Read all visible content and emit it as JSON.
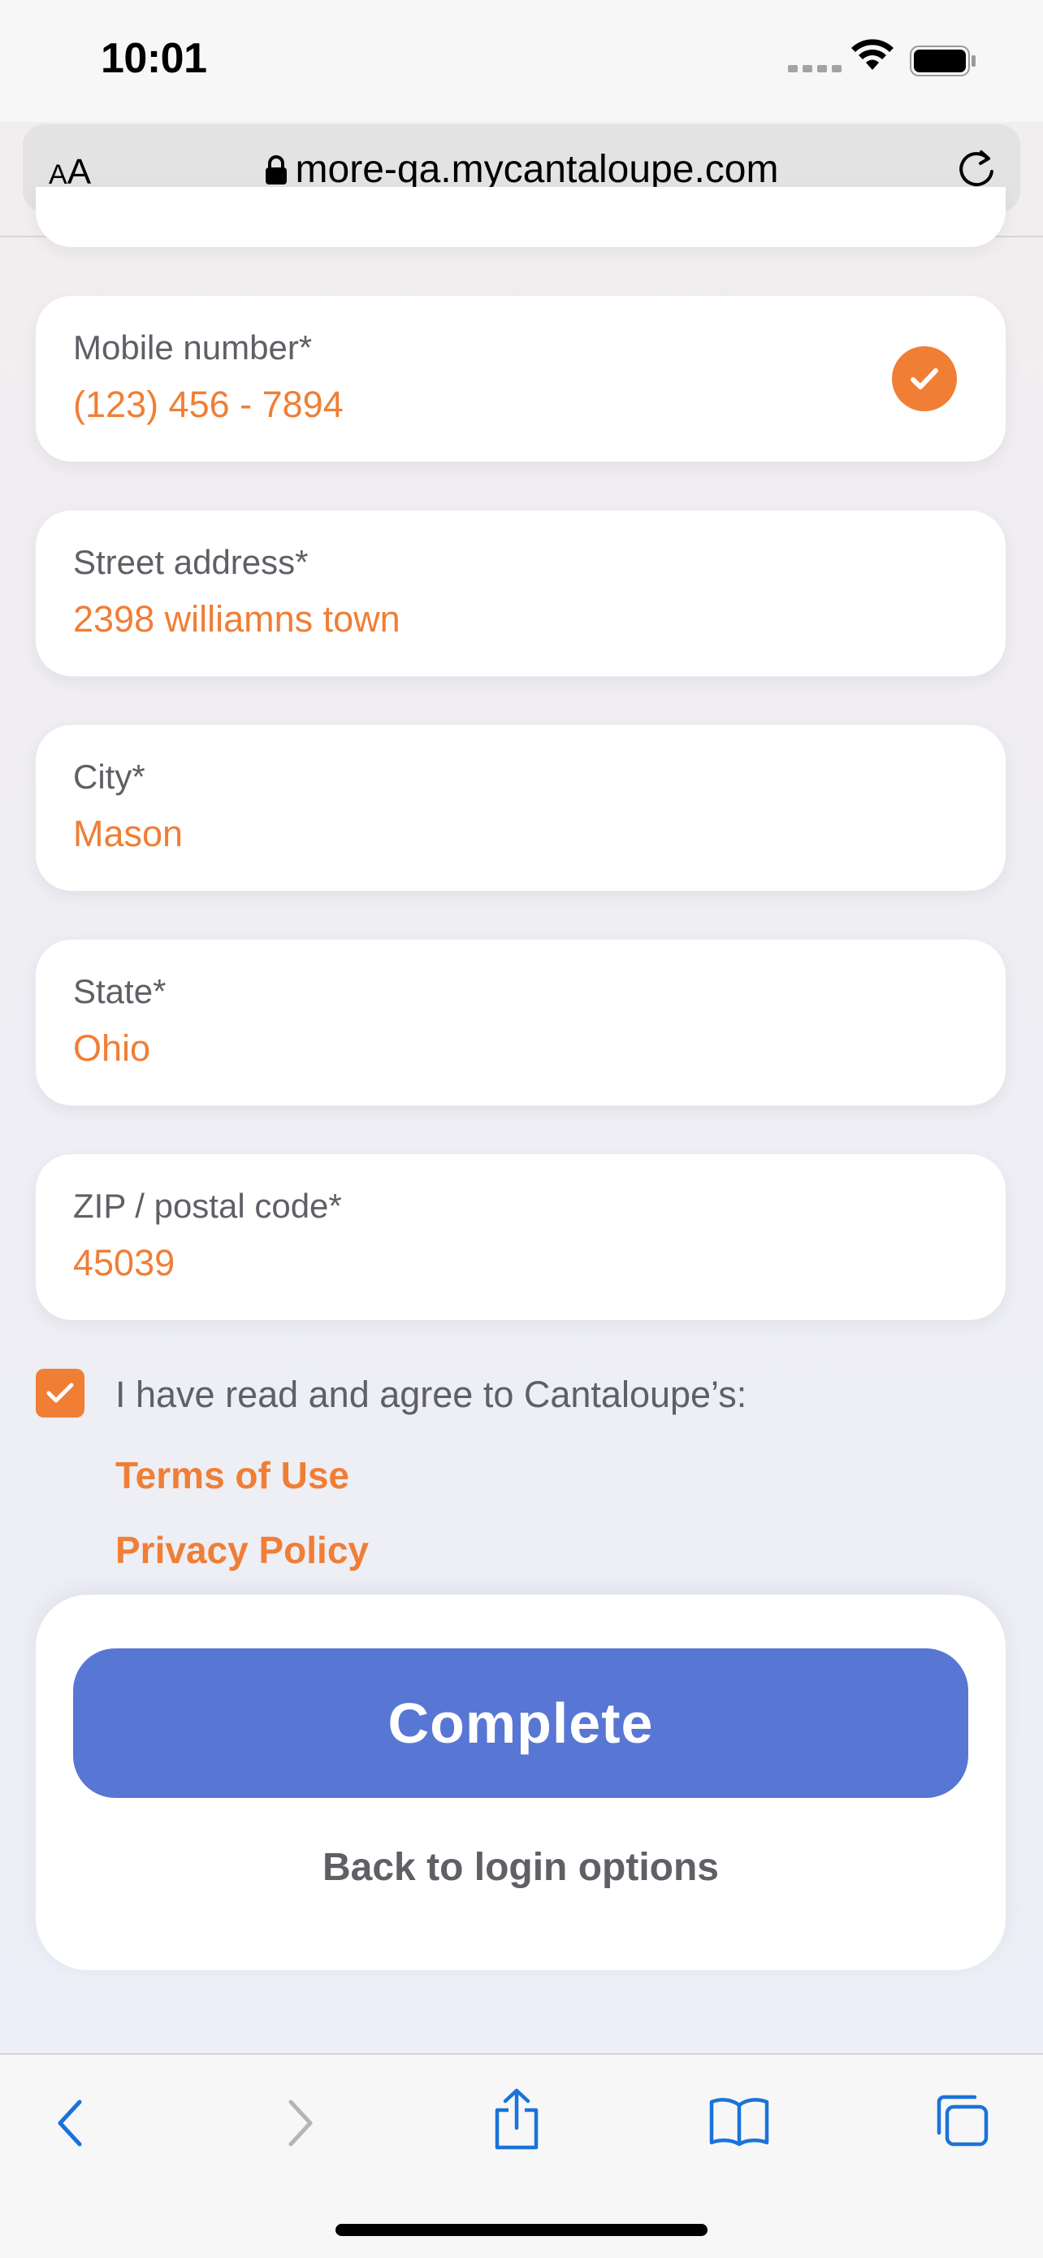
{
  "status_bar": {
    "time": "10:01"
  },
  "browser": {
    "text_size_label_small": "A",
    "text_size_label_big": "A",
    "url": "more-qa.mycantaloupe.com"
  },
  "form": {
    "mobile": {
      "label": "Mobile number*",
      "value": "(123) 456 - 7894",
      "validated": true
    },
    "street": {
      "label": "Street address*",
      "value": "2398 williamns town"
    },
    "city": {
      "label": "City*",
      "value": "Mason"
    },
    "state": {
      "label": "State*",
      "value": "Ohio"
    },
    "zip": {
      "label": "ZIP / postal code*",
      "value": "45039"
    },
    "agree": {
      "checked": true,
      "text": "I have read and agree to Cantaloupe’s:",
      "terms_link": "Terms of Use",
      "privacy_link": "Privacy Policy"
    }
  },
  "actions": {
    "complete_label": "Complete",
    "back_label": "Back to login options"
  },
  "toolbar": {
    "icons": [
      "back-icon",
      "forward-icon",
      "share-icon",
      "bookmarks-icon",
      "tabs-icon"
    ]
  },
  "colors": {
    "accent_orange": "#f07e35",
    "primary_blue": "#5876d3",
    "ios_blue": "#1a73d9"
  }
}
